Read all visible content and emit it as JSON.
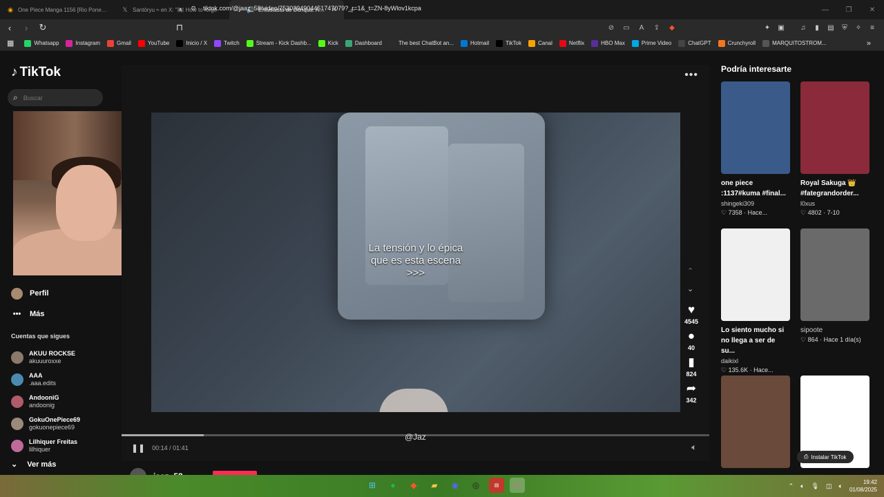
{
  "tabs": [
    {
      "title": "One Piece Manga 1156 [Rio Poneglyph"
    },
    {
      "title": "Santōryu ≈ en X: \"🏴‍☠️ How to forge"
    },
    {
      "title": "Entusiasta de Donqua: Análisis"
    }
  ],
  "address": {
    "url": "tiktok.com/@jaaz_58/video/7530394904451747079?_r=1&_t=ZN-8yWlov1kcpa"
  },
  "bookmarks": [
    {
      "label": "Whatsapp",
      "color": "#25d366"
    },
    {
      "label": "Instagram",
      "color": "#d6249f"
    },
    {
      "label": "Gmail",
      "color": "#ea4335"
    },
    {
      "label": "YouTube",
      "color": "#ff0000"
    },
    {
      "label": "Inicio / X",
      "color": "#000000"
    },
    {
      "label": "Twitch",
      "color": "#9146ff"
    },
    {
      "label": "Stream - Kick Dashb...",
      "color": "#53fc18"
    },
    {
      "label": "Kick",
      "color": "#53fc18"
    },
    {
      "label": "Dashboard",
      "color": "#3aa675"
    },
    {
      "label": "The best ChatBot an...",
      "color": "#2b2b2b"
    },
    {
      "label": "Hotmail",
      "color": "#0078d4"
    },
    {
      "label": "TikTok",
      "color": "#000000"
    },
    {
      "label": "Canal",
      "color": "#f4a300"
    },
    {
      "label": "Netflix",
      "color": "#e50914"
    },
    {
      "label": "HBO Max",
      "color": "#5a2d9c"
    },
    {
      "label": "Prime Video",
      "color": "#00a8e1"
    },
    {
      "label": "ChatGPT",
      "color": "#444444"
    },
    {
      "label": "Crunchyroll",
      "color": "#f47521"
    },
    {
      "label": "MARQUITOSTROM...",
      "color": "#555555"
    }
  ],
  "sidebar": {
    "logo": "TikTok",
    "search_placeholder": "Buscar",
    "profile": "Perfil",
    "more": "Más",
    "following_header": "Cuentas que sigues",
    "accounts": [
      {
        "name": "AKUU ROCKSE",
        "handle": "akuuuroxxe",
        "color": "#8a7a6a"
      },
      {
        "name": "AAA",
        "handle": ".aaa.edits",
        "color": "#4a8ab0"
      },
      {
        "name": "AndooniG",
        "handle": "andoonig",
        "color": "#b05a6a"
      },
      {
        "name": "GokuOnePiece69",
        "handle": "gokuonepiece69",
        "color": "#9a8a7a"
      },
      {
        "name": "Lilhiquer Freitas",
        "handle": "lilhiquer",
        "color": "#c06a9a"
      }
    ],
    "see_more": "Ver más"
  },
  "video": {
    "caption": "La tensión y lo épica\nque es esta escena\n>>>",
    "author_tag": "@Jaz",
    "time": "00:14 / 01:41",
    "progress": 0.14,
    "bottom_user": "jaaz_58"
  },
  "actions": {
    "likes": "4545",
    "comments": "40",
    "saves": "824",
    "shares": "342"
  },
  "recommend": {
    "title": "Podría interesarte",
    "items": [
      {
        "title": "one piece\n:1137#kuma #final...",
        "author": "shingeki309",
        "stats": "7358 · Hace...",
        "thumb": "#3a5a8a"
      },
      {
        "title": "Royal Sakuga 👑\n#fategrandorder...",
        "author": "l0xus",
        "stats": "4802 · 7-10",
        "thumb": "#8a2a3a"
      },
      {
        "title": "Lo siento mucho si\nno llega a ser de su...",
        "author": "daikixl",
        "stats": "135.6K · Hace...",
        "thumb": "#f0f0f0"
      },
      {
        "title": "",
        "author": "sipoote",
        "stats": "864 · Hace 1 día(s)",
        "thumb": "#6a6a6a"
      }
    ],
    "install": "Instalar TikTok"
  },
  "taskbar": {
    "time": "19:42",
    "date": "01/08/2025"
  }
}
